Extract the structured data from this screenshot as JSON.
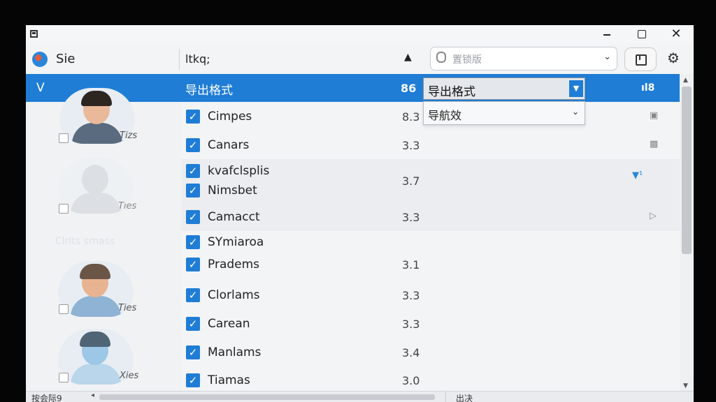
{
  "app": {
    "name": "Sie"
  },
  "toolbar": {
    "label": "ltkq;",
    "search_placeholder": "置锁版"
  },
  "header": {
    "v": "V",
    "title": "导出格式",
    "value": "86",
    "right": "ıl8"
  },
  "dropdown": {
    "selected": "导出格式",
    "second": "导航效"
  },
  "avatars": [
    {
      "tag": "Tizs"
    },
    {
      "tag": "Tıes"
    },
    {
      "tag": "Ties"
    },
    {
      "tag": "Xies"
    }
  ],
  "ghost_text": "Clrlts srnass",
  "rows": [
    {
      "names": [
        "Cimpes"
      ],
      "value": "8.3",
      "icon": "▣"
    },
    {
      "names": [
        "Canars"
      ],
      "value": "3.3",
      "icon": "▩"
    },
    {
      "names": [
        "kvafclsplis",
        "Nimsbet"
      ],
      "value": "3.7",
      "icon": "▼¹"
    },
    {
      "names": [
        "Camacct"
      ],
      "value": "3.3",
      "icon": "▷"
    },
    {
      "names": [
        "SYmiaroa"
      ],
      "value": "",
      "icon": ""
    },
    {
      "names": [
        "Pradems"
      ],
      "value": "3.1",
      "icon": ""
    },
    {
      "names": [
        "Clorlams"
      ],
      "value": "3.3",
      "icon": ""
    },
    {
      "names": [
        "Carean"
      ],
      "value": "3.3",
      "icon": ""
    },
    {
      "names": [
        "Manlams"
      ],
      "value": "3.4",
      "icon": ""
    },
    {
      "names": [
        "Tiamas"
      ],
      "value": "3.0",
      "icon": ""
    }
  ],
  "status": {
    "left": "按会际9",
    "right": "出决"
  },
  "colors": {
    "accent": "#1f7dd6"
  },
  "icons": {
    "close": "✕",
    "gear": "⚙",
    "pin": "▲"
  }
}
